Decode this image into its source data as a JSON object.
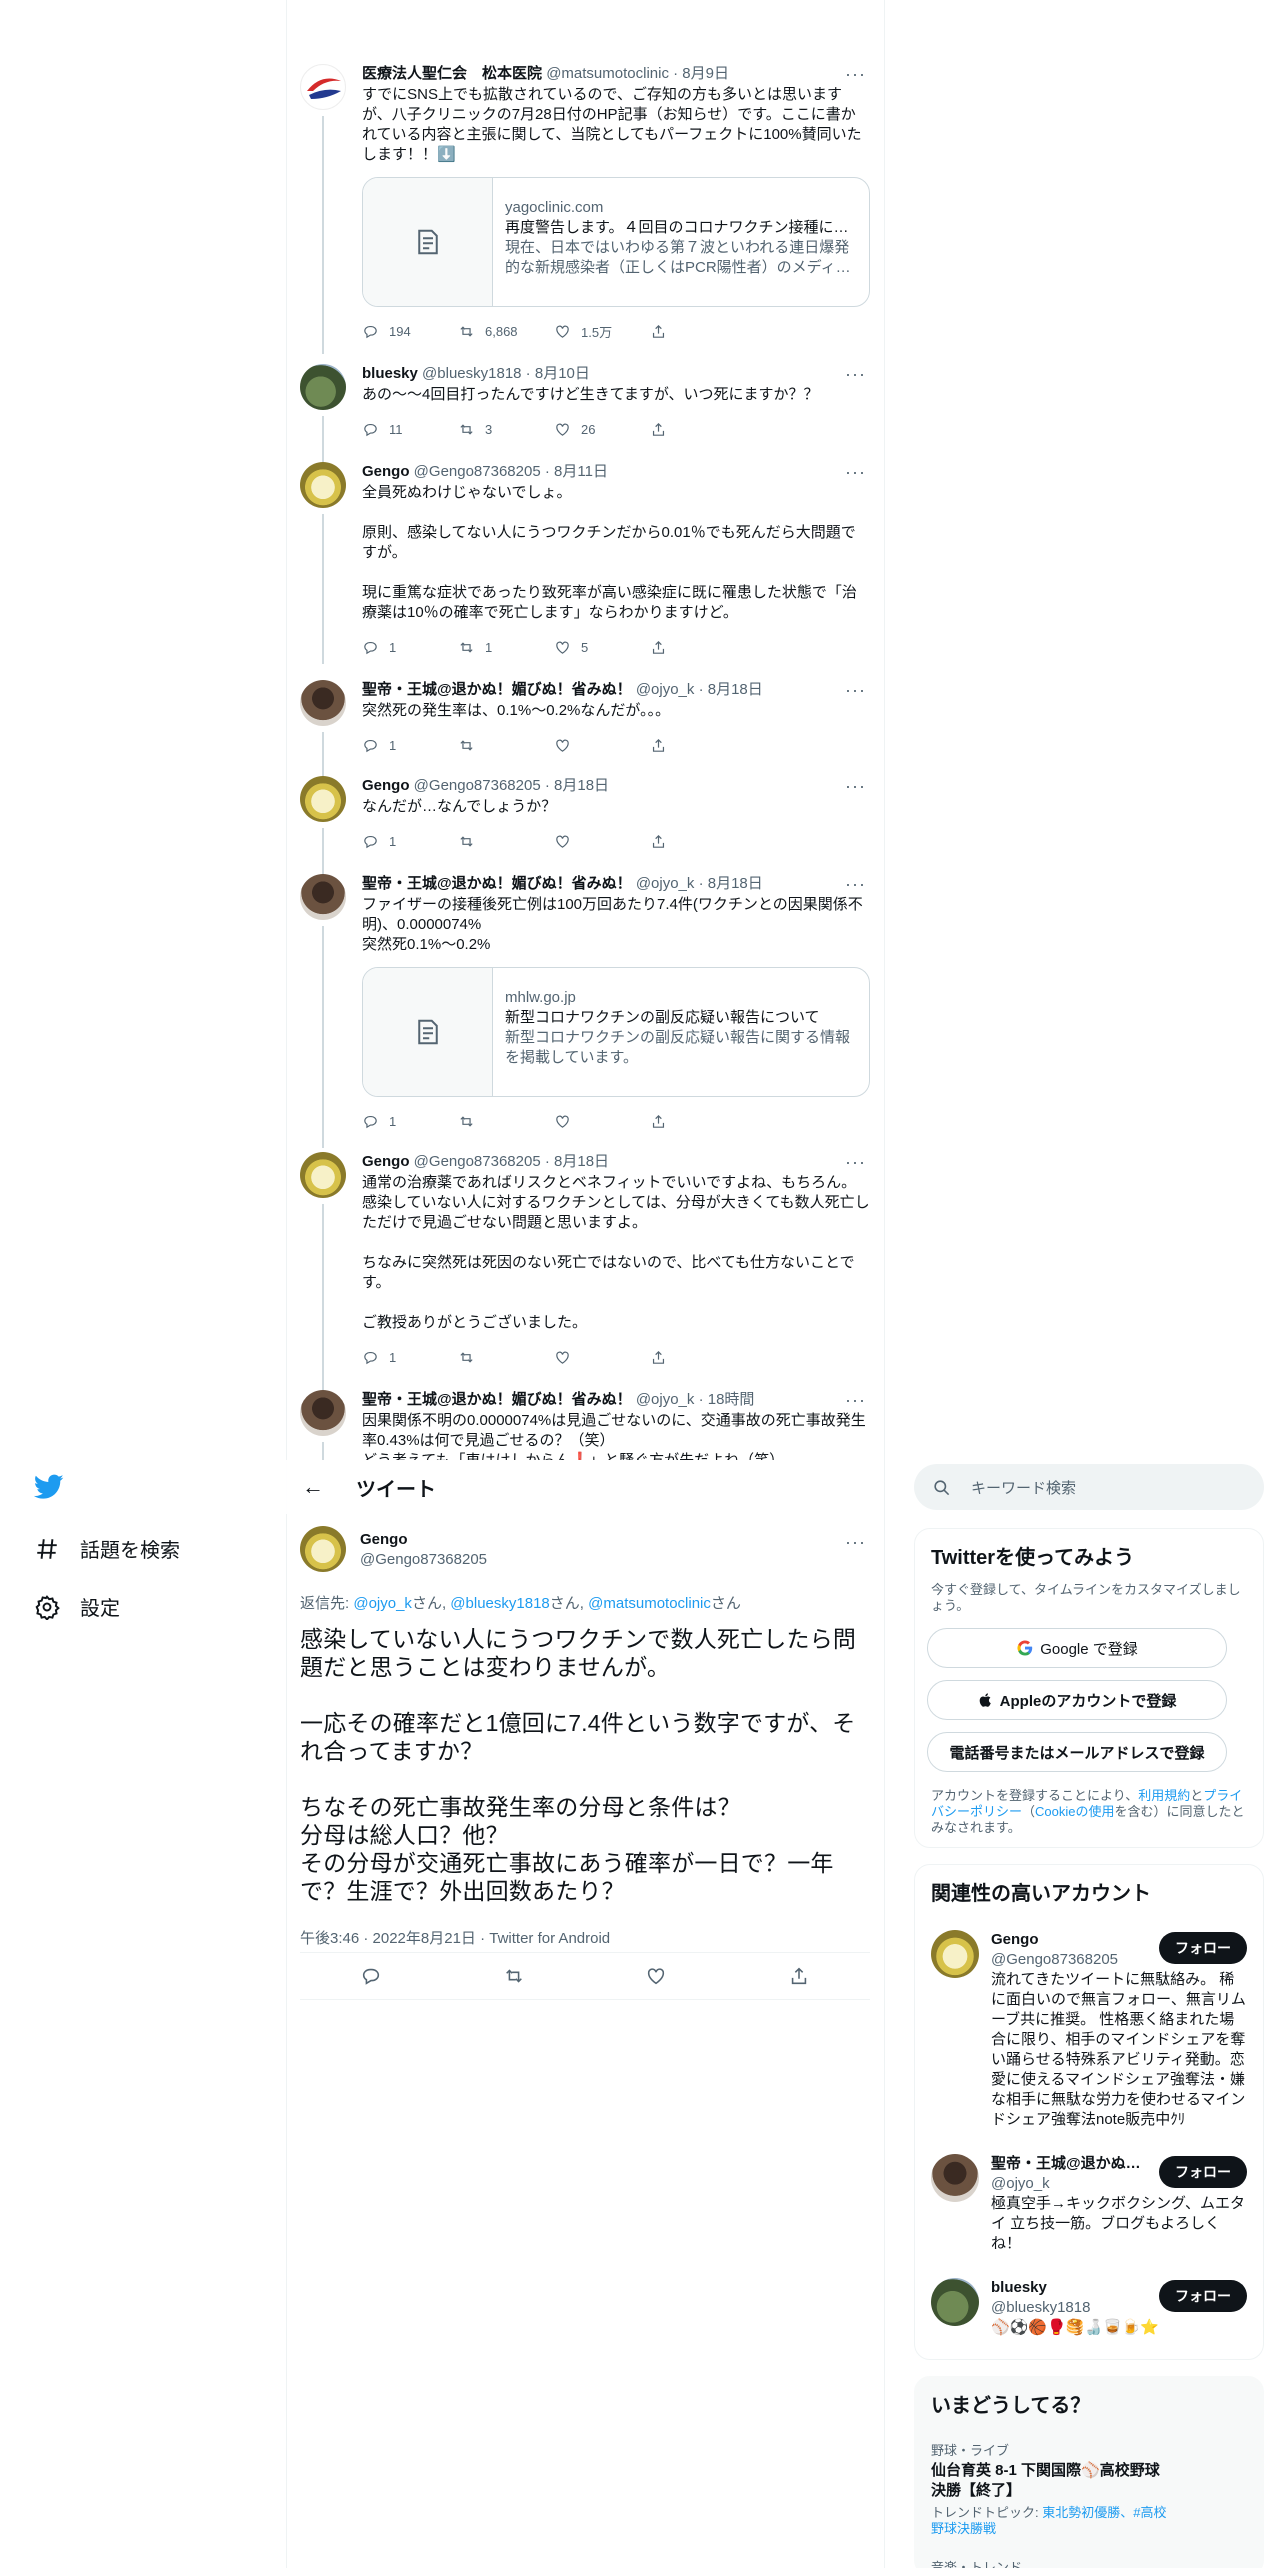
{
  "nav": {
    "explore": "話題を検索",
    "settings": "設定"
  },
  "header": {
    "back": "←",
    "title": "ツイート"
  },
  "thread": [
    {
      "name": "医療法人聖仁会　松本医院",
      "handle": "@matsumotoclinic",
      "date": "8月9日",
      "text": "すでにSNS上でも拡散されているので、ご存知の方も多いとは思いますが、八子クリニックの7月28日付のHP記事（お知らせ）です。ここに書かれている内容と主張に関して、当院としてもパーフェクトに100%賛同いたします！！⬇️",
      "card": {
        "domain": "yagoclinic.com",
        "title": "再度警告します。４回目のコロナワクチン接種に…",
        "desc": "現在、日本ではいわゆる第７波といわれる連日爆発的な新規感染者（正しくはPCR陽性者）のメディ…"
      },
      "replies": "194",
      "retweets": "6,868",
      "likes": "1.5万"
    },
    {
      "name": "bluesky",
      "handle": "@bluesky1818",
      "date": "8月10日",
      "text": "あの〜〜4回目打ったんですけど生きてますが、いつ死にますか？？",
      "replies": "11",
      "retweets": "3",
      "likes": "26"
    },
    {
      "name": "Gengo",
      "handle": "@Gengo87368205",
      "date": "8月11日",
      "text": "全員死ぬわけじゃないでしょ。\n\n原則、感染してない人にうつワクチンだから0.01％でも死んだら大問題ですが。\n\n現に重篤な症状であったり致死率が高い感染症に既に罹患した状態で「治療薬は10％の確率で死亡します」ならわかりますけど。",
      "replies": "1",
      "retweets": "1",
      "likes": "5"
    },
    {
      "name": "聖帝・王城@退かぬ！媚びぬ！省みぬ！",
      "handle": "@ojyo_k",
      "date": "8月18日",
      "text": "突然死の発生率は、0.1%〜0.2%なんだが。。。",
      "replies": "1",
      "retweets": "",
      "likes": ""
    },
    {
      "name": "Gengo",
      "handle": "@Gengo87368205",
      "date": "8月18日",
      "text": "なんだが…なんでしょうか？",
      "replies": "1",
      "retweets": "",
      "likes": ""
    },
    {
      "name": "聖帝・王城@退かぬ！媚びぬ！省みぬ！",
      "handle": "@ojyo_k",
      "date": "8月18日",
      "text": "ファイザーの接種後死亡例は100万回あたり7.4件(ワクチンとの因果関係不明)、0.0000074%\n突然死0.1%〜0.2%",
      "card": {
        "domain": "mhlw.go.jp",
        "title": "新型コロナワクチンの副反応疑い報告について",
        "desc": "新型コロナワクチンの副反応疑い報告に関する情報を掲載しています。"
      },
      "replies": "1",
      "retweets": "",
      "likes": ""
    },
    {
      "name": "Gengo",
      "handle": "@Gengo87368205",
      "date": "8月18日",
      "text": "通常の治療薬であればリスクとベネフィットでいいですよね、もちろん。\n感染していない人に対するワクチンとしては、分母が大きくても数人死亡しただけで見過ごせない問題と思いますよ。\n\nちなみに突然死は死因のない死亡ではないので、比べても仕方ないことです。\n\nご教授ありがとうございました。",
      "replies": "1",
      "retweets": "",
      "likes": ""
    },
    {
      "name": "聖帝・王城@退かぬ！媚びぬ！省みぬ！",
      "handle": "@ojyo_k",
      "date": "18時間",
      "text": "因果関係不明の0.0000074%は見過ごせないのに、交通事故の死亡事故発生率0.43%は何で見過ごせるの？（笑）\nどう考えても「車はけしからん❗」と騒ぐ方が先だよね（笑）"
    }
  ],
  "focus": {
    "name": "Gengo",
    "handle": "@Gengo87368205",
    "reply_prefix": "返信先: ",
    "reply_to": [
      "@ojyo_k",
      "@bluesky1818",
      "@matsumotoclinic"
    ],
    "reply_suffix": "さん",
    "text": "感染していない人にうつワクチンで数人死亡したら問題だと思うことは変わりませんが。\n\n一応その確率だと1億回に7.4件という数字ですが、それ合ってますか？\n\nちなその死亡事故発生率の分母と条件は？\n分母は総人口？他？\nその分母が交通死亡事故にあう確率が一日で？一年で？生涯で？外出回数あたり？",
    "meta": "午後3:46 · 2022年8月21日 · Twitter for Android"
  },
  "search": {
    "placeholder": "キーワード検索"
  },
  "signup": {
    "title": "Twitterを使ってみよう",
    "subtitle": "今すぐ登録して、タイムラインをカスタマイズしましょう。",
    "google": "Google で登録",
    "apple": "Appleのアカウントで登録",
    "phone": "電話番号またはメールアドレスで登録",
    "legal_1": "アカウントを登録することにより、",
    "legal_terms": "利用規約",
    "legal_2": "と",
    "legal_privacy": "プライバシーポリシー",
    "legal_3": "（",
    "legal_cookie": "Cookieの使用",
    "legal_4": "を含む）に同意したとみなされます。"
  },
  "related": {
    "title": "関連性の高いアカウント",
    "follow_label": "フォロー",
    "accounts": [
      {
        "name": "Gengo",
        "handle": "@Gengo87368205",
        "bio": "流れてきたツイートに無駄絡み。 稀に面白いので無言フォロー、無言リムーブ共に推奨。 性格悪く絡まれた場合に限り、相手のマインドシェアを奪い踊らせる特殊系アビリティ発動。恋愛に使えるマインドシェア強奪法・嫌な相手に無駄な労力を使わせるマインドシェア強奪法note販売中ｸﾘ"
      },
      {
        "name": "聖帝・王城@退かぬ！媚びぬ！省みぬ！",
        "handle": "@ojyo_k",
        "bio": "極真空手→キックボクシング、ムエタイ 立ち技一筋。ブログもよろしくね！"
      },
      {
        "name": "bluesky",
        "handle": "@bluesky1818",
        "bio": "⚾️⚽️🏀🥊🥞🍶🥃🍺⭐"
      }
    ]
  },
  "trends": {
    "title": "いまどうしてる？",
    "items": [
      {
        "context": "野球・ライブ",
        "topic": "仙台育英 8-1 下関国際⚾高校野球決勝【終了】",
        "sub_label": "トレンドトピック: ",
        "sub_links": "東北勢初優勝、#高校野球決勝戦"
      },
      {
        "context": "音楽・トレンド",
        "topic": ""
      }
    ]
  }
}
